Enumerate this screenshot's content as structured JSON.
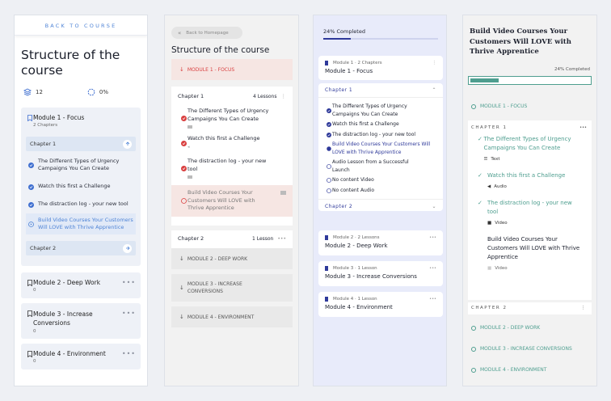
{
  "panel1": {
    "back_label": "BACK TO COURSE",
    "title": "Structure of the course",
    "lessons_count": "12",
    "progress": "0%",
    "module1": {
      "title": "Module 1 - Focus",
      "sub": "2 Chapters"
    },
    "chapter1": "Chapter 1",
    "lessons": [
      "The Different Types of Urgency Campaigns You Can Create",
      "Watch this first a Challenge",
      "The distraction log - your new tool",
      "Build Video Courses Your Customers Will LOVE with Thrive Apprentice"
    ],
    "chapter2": "Chapter 2",
    "modules": [
      {
        "title": "Module 2 - Deep Work",
        "sub": "0"
      },
      {
        "title": "Module 3 - Increase Conversions",
        "sub": "0"
      },
      {
        "title": "Module 4 - Environment",
        "sub": "0"
      }
    ]
  },
  "panel2": {
    "back_label": "Back to Homepage",
    "title": "Structure of the course",
    "module1": "MODULE 1 - FOCUS",
    "chapter1": "Chapter 1",
    "chapter1_count": "4 Lessons",
    "lessons": [
      "The Different Types of Urgency Campaigns You Can Create",
      "Watch this first a Challenge",
      "The distraction log - your new tool",
      "Build Video Courses Your Customers Will LOVE with Thrive Apprentice"
    ],
    "chapter2": "Chapter 2",
    "chapter2_count": "1 Lesson",
    "modules": [
      "MODULE 2 - DEEP WORK",
      "MODULE 3 - INCREASE CONVERSIONS",
      "MODULE 4 - ENVIRONMENT"
    ]
  },
  "panel3": {
    "progress_label": "24% Completed",
    "progress_value": 0.24,
    "module1": {
      "sub": "Module 1  ·  2 Chapters",
      "title": "Module 1 - Focus"
    },
    "chapter1": "Chapter 1",
    "lessons": [
      "The Different Types of Urgency Campaigns You Can Create",
      "Watch this first a Challenge",
      "The distraction log - your new tool",
      "Build Video Courses Your Customers Will LOVE with Thrive Apprentice",
      "Audio Lesson from a Successful Launch",
      "No content Video",
      "No content Audio"
    ],
    "chapter2": "Chapter 2",
    "modules": [
      {
        "sub": "Module 2  ·  2 Lessons",
        "title": "Module 2 - Deep Work"
      },
      {
        "sub": "Module 3  ·  1 Lesson",
        "title": "Module 3 - Increase Conversions"
      },
      {
        "sub": "Module 4  ·  1 Lesson",
        "title": "Module 4 - Environment"
      }
    ]
  },
  "panel4": {
    "title": "Build Video Courses Your Customers Will LOVE with Thrive Apprentice",
    "progress_label": "24% Completed",
    "progress_value": 0.24,
    "module1": "MODULE 1 - FOCUS",
    "chapter1": "CHAPTER 1",
    "lessons": [
      {
        "title": "The Different Types of Urgency Campaigns You Can Create",
        "type": "Text"
      },
      {
        "title": "Watch this first a Challenge",
        "type": "Audio"
      },
      {
        "title": "The distraction log - your new tool",
        "type": "Video"
      },
      {
        "title": "Build Video Courses Your Customers Will LOVE with Thrive Apprentice",
        "type": "Video"
      }
    ],
    "chapter2": "CHAPTER 2",
    "modules": [
      "MODULE 2 - DEEP WORK",
      "MODULE 3 - INCREASE CONVERSIONS",
      "MODULE 4 - ENVIRONMENT"
    ]
  },
  "colors": {
    "blue": "#4f84d6",
    "navy": "#2f3a9a",
    "red": "#d94040",
    "green": "#4e9e8f"
  }
}
